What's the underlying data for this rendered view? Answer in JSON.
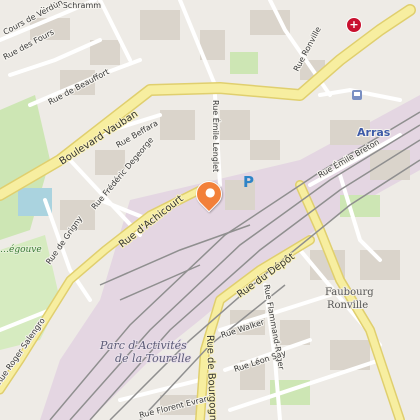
{
  "map": {
    "title": "Map",
    "labels": {
      "top_place": "... de Schramm",
      "boulevard_vauban": "Boulevard Vauban",
      "rue_emile_lenglet": "Rue Émile Lenglet",
      "rue_beffara": "Rue Beffara",
      "rue_frederic_degeorge": "Rue Frédéric Degeorge",
      "rue_dachicourt": "Rue d'Achicourt",
      "rue_de_gribaval": "Rue de Grigny",
      "rue_de_beauffort": "Rue de Beauffort",
      "rue_des_fours": "Rue des Fours",
      "cours_de_verdun": "Cours de Verdun",
      "rue_ronville": "Rue Ronville",
      "rue_emile_breton": "Rue Émile Breton",
      "rue_du_depot": "Rue du Dépôt",
      "rue_flammand_roger": "Rue Flammand-Roger",
      "rue_walker": "Rue Walker",
      "rue_leon_say": "Rue Léon Say",
      "rue_florent_evrard": "Rue Florent Evrard",
      "rue_de_bourgogne": "Rue de Bourgogne",
      "rue_roger_salengro": "Rue Roger Salengro",
      "district_faubourg": "Faubourg",
      "district_ronville": "Ronville",
      "park_area_line1": "Parc d'Activités",
      "park_area_line2": "de la Tourelle",
      "city": "Arras",
      "green_gouve": "…égouve"
    },
    "icons": {
      "marker": "tourist-office-marker-icon",
      "parking": "P",
      "hospital": "+"
    },
    "colors": {
      "background": "#eeebe6",
      "major_road": "#f7eea0",
      "major_road_casing": "#e0cf6e",
      "park": "#cde6b4",
      "railway_area": "#e4d6e2",
      "rail": "#8a8a8a",
      "water": "#aad3df",
      "building": "#dad4cb",
      "marker": "#f2803a",
      "parking": "#2e84c7",
      "hospital": "#c8102e"
    }
  }
}
